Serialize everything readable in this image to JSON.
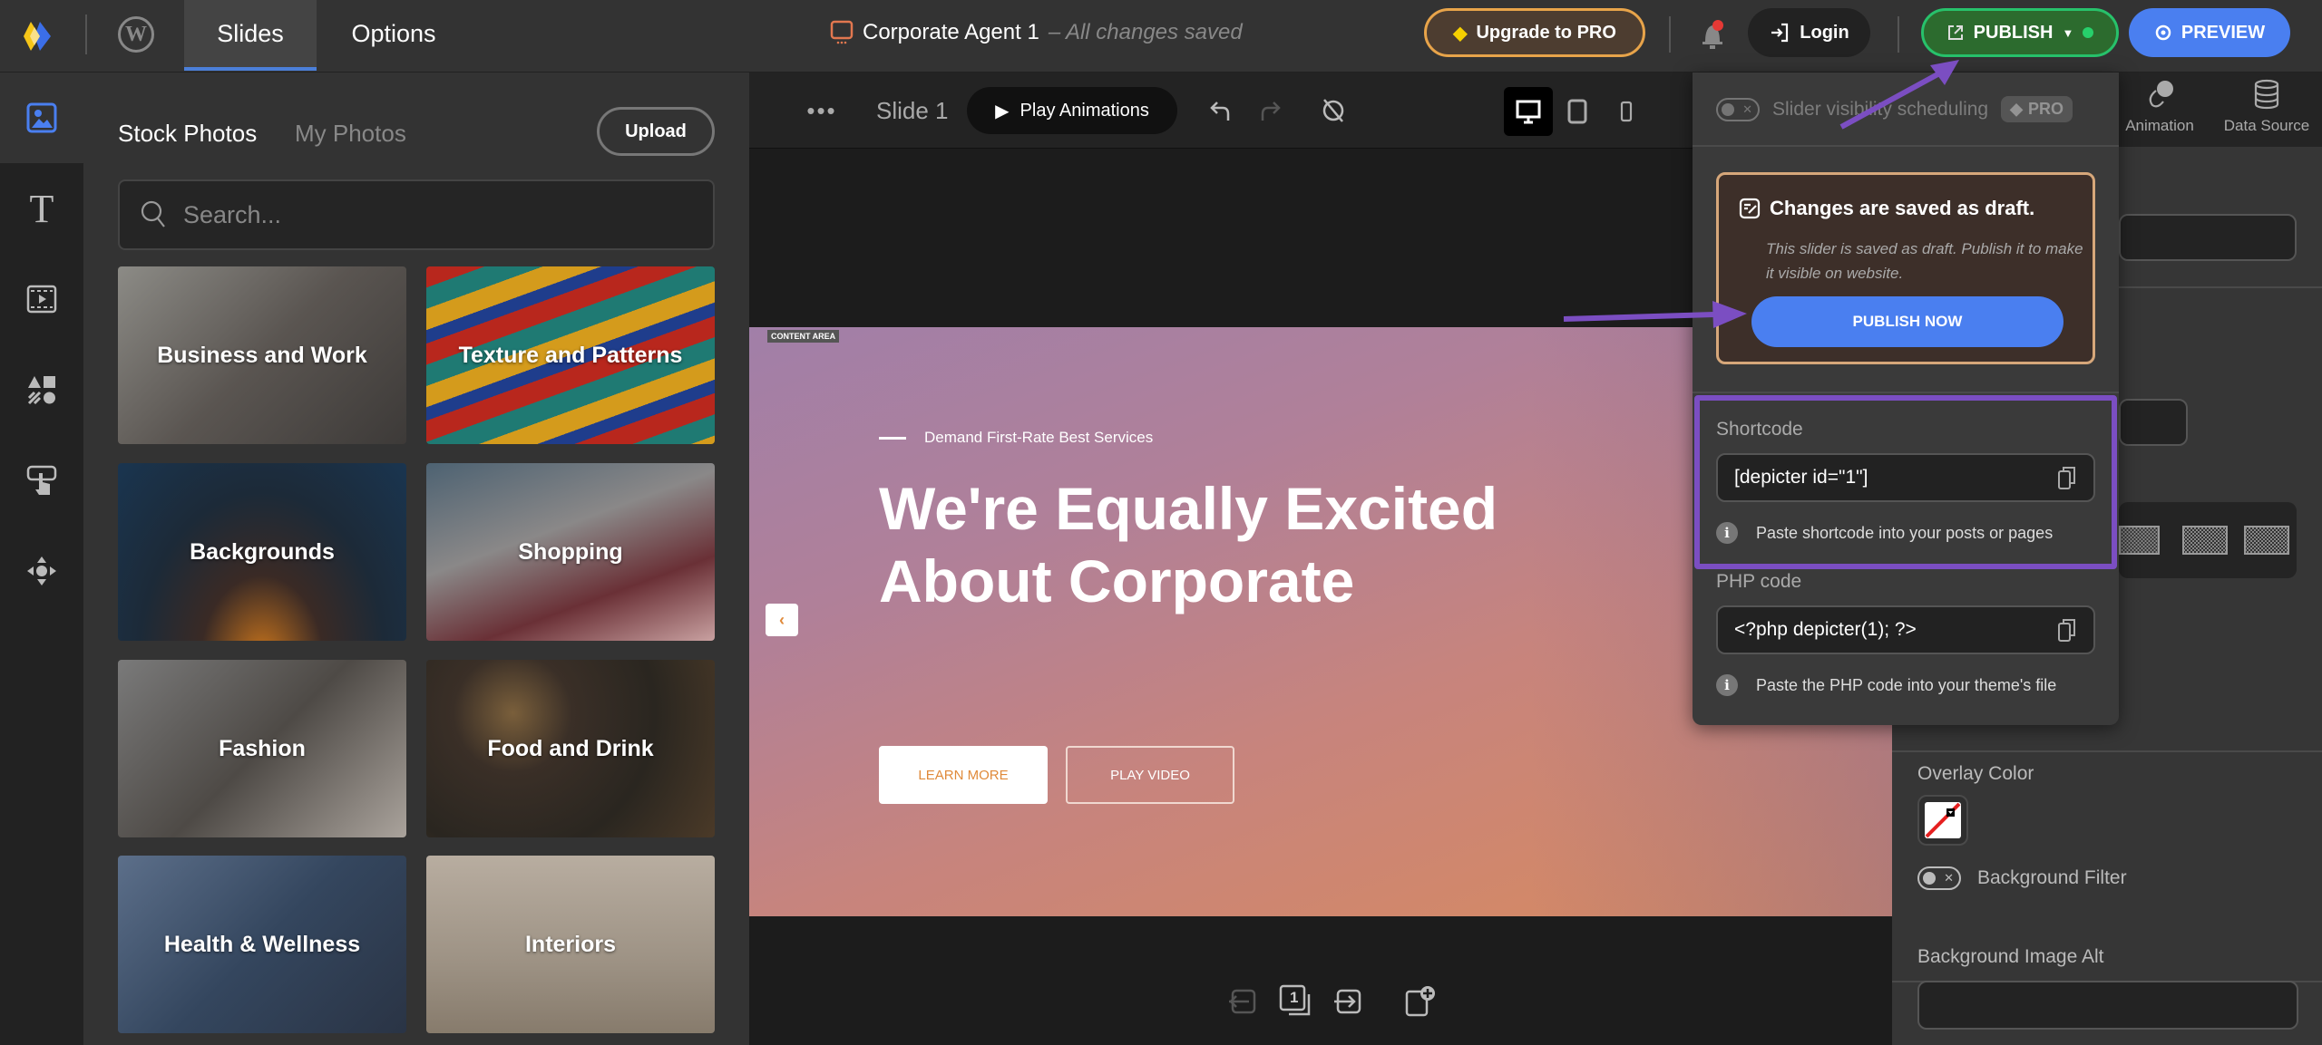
{
  "topbar": {
    "tabs": [
      {
        "label": "Slides",
        "active": true
      },
      {
        "label": "Options",
        "active": false
      }
    ],
    "document_title": "Corporate Agent 1",
    "save_status": "– All changes saved",
    "upgrade_label": "Upgrade to PRO",
    "login_label": "Login",
    "publish_label": "PUBLISH",
    "preview_label": "PREVIEW"
  },
  "icon_sidebar": {
    "items": [
      {
        "icon": "image-icon",
        "active": true
      },
      {
        "icon": "text-icon",
        "glyph": "T"
      },
      {
        "icon": "video-icon"
      },
      {
        "icon": "shapes-icon"
      },
      {
        "icon": "button-click-icon"
      },
      {
        "icon": "move-arrows-icon"
      }
    ]
  },
  "media_panel": {
    "tabs": [
      {
        "label": "Stock Photos",
        "active": true
      },
      {
        "label": "My Photos",
        "active": false
      }
    ],
    "upload_label": "Upload",
    "search_placeholder": "Search...",
    "categories": [
      {
        "label": "Business and Work"
      },
      {
        "label": "Texture and Patterns"
      },
      {
        "label": "Backgrounds"
      },
      {
        "label": "Shopping"
      },
      {
        "label": "Fashion"
      },
      {
        "label": "Food and Drink"
      },
      {
        "label": "Health & Wellness"
      },
      {
        "label": "Interiors"
      }
    ]
  },
  "canvas_toolbar": {
    "slide_name": "Slide 1",
    "play_label": "Play Animations",
    "devices": [
      "desktop",
      "tablet",
      "mobile"
    ],
    "active_device": "desktop"
  },
  "slide": {
    "content_area_label": "CONTENT AREA",
    "eyebrow": "Demand First-Rate Best Services",
    "headline": "We're Equally Excited About Corporate",
    "button_primary": "LEARN MORE",
    "button_secondary": "PLAY VIDEO"
  },
  "slide_nav": {
    "current_slide": "1"
  },
  "publish_popover": {
    "scheduling_label": "Slider visibility scheduling",
    "pro_badge": "PRO",
    "draft_title": "Changes are saved as draft.",
    "draft_text": "This slider is saved as draft. Publish it to make it visible on website.",
    "publish_now_label": "PUBLISH NOW",
    "shortcode_label": "Shortcode",
    "shortcode_value": "[depicter id=\"1\"]",
    "shortcode_hint": "Paste shortcode into your posts or pages",
    "php_label": "PHP code",
    "php_value": "<?php depicter(1); ?>",
    "php_hint": "Paste the PHP code into your theme's file"
  },
  "right_panel": {
    "tabs": [
      {
        "label": "Animation"
      },
      {
        "label": "Data Source"
      }
    ],
    "overlay_color_label": "Overlay Color",
    "background_filter_label": "Background Filter",
    "background_image_alt_label": "Background Image Alt",
    "background_image_alt_value": ""
  },
  "colors": {
    "accent_blue": "#4a7ff0",
    "publish_green": "#27c26b",
    "upgrade_orange": "#e8a44a",
    "highlight_purple": "#7b4ec2"
  }
}
